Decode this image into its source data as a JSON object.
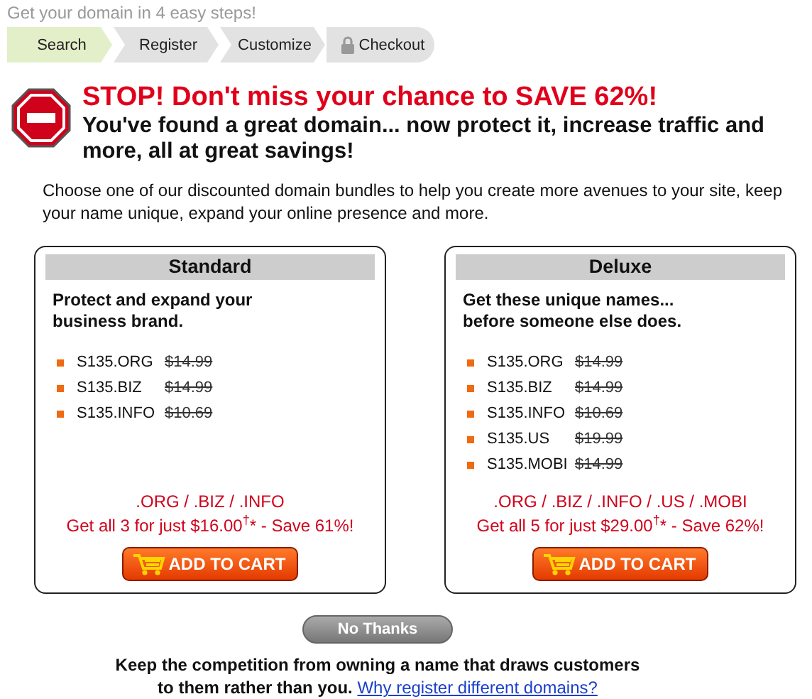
{
  "intro": "Get your domain in 4 easy steps!",
  "steps": [
    {
      "label": "Search",
      "selected": true,
      "locked": false
    },
    {
      "label": "Register",
      "selected": false,
      "locked": false
    },
    {
      "label": "Customize",
      "selected": false,
      "locked": false
    },
    {
      "label": "Checkout",
      "selected": false,
      "locked": true
    }
  ],
  "headline": "STOP! Don't miss your chance to SAVE 62%!",
  "subheadline": "You've found a great domain... now protect it, increase traffic and more, all at great savings!",
  "description": "Choose one of our discounted domain bundles to help you create more avenues to your site, keep your name unique, expand your online presence and more.",
  "bundles": [
    {
      "title": "Standard",
      "tagline": "Protect and expand your business brand.",
      "domains": [
        {
          "name": "S135.ORG",
          "price": "$14.99"
        },
        {
          "name": "S135.BIZ",
          "price": "$14.99"
        },
        {
          "name": "S135.INFO",
          "price": "$10.69"
        }
      ],
      "extensions": ".ORG / .BIZ / .INFO",
      "offer": "Get all 3 for just $16.00$^{†}$* - Save 61%!",
      "button": "ADD TO CART"
    },
    {
      "title": "Deluxe",
      "tagline": "Get these unique names... before someone else does.",
      "domains": [
        {
          "name": "S135.ORG",
          "price": "$14.99"
        },
        {
          "name": "S135.BIZ",
          "price": "$14.99"
        },
        {
          "name": "S135.INFO",
          "price": "$10.69"
        },
        {
          "name": "S135.US",
          "price": "$19.99"
        },
        {
          "name": "S135.MOBI",
          "price": "$14.99"
        }
      ],
      "extensions": ".ORG / .BIZ / .INFO / .US / .MOBI",
      "offer": "Get all 5 for just $29.00$^{†}$* - Save 62%!",
      "button": "ADD TO CART"
    }
  ],
  "decline_button": "No Thanks",
  "footer_text": "Keep the competition from owning a name that draws customers to them rather than you.",
  "footer_link": "Why register different domains?"
}
